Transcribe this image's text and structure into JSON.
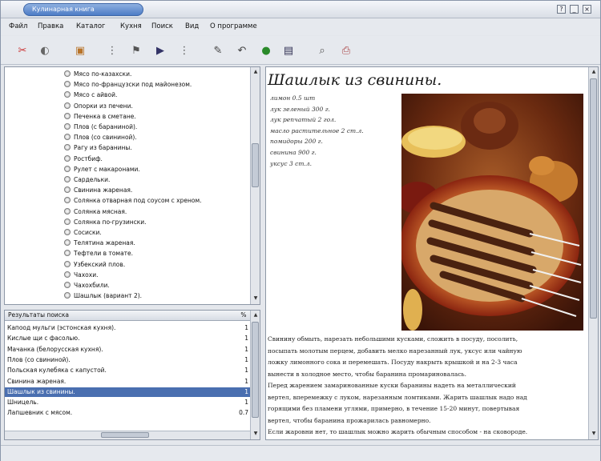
{
  "window": {
    "title": "Кулинарная книга"
  },
  "menu": [
    "Файл",
    "Правка",
    "Каталог",
    "Кухня",
    "Поиск",
    "Вид",
    "О программе"
  ],
  "toolbar": [
    "cut-icon",
    "eraser-icon",
    "book-icon",
    "bookmark-icon",
    "flag-icon",
    "play-icon",
    "bookmark-2-icon",
    "edit-icon",
    "undo-icon",
    "globe-icon",
    "paint-icon",
    "search-icon",
    "print-icon"
  ],
  "tree": [
    "Мясо по-казахски.",
    "Мясо по-французски под майонезом.",
    "Мясо с айвой.",
    "Опорки из печени.",
    "Печенка в сметане.",
    "Плов (с бараниной).",
    "Плов (со свининой).",
    "Рагу из баранины.",
    "Ростбиф.",
    "Рулет с макаронами.",
    "Сардельки.",
    "Свинина жареная.",
    "Солянка отварная под соусом с хреном.",
    "Солянка мясная.",
    "Солянка по-грузински.",
    "Сосиски.",
    "Телятина жареная.",
    "Тефтели в томате.",
    "Узбекский плов.",
    "Чахохи.",
    "Чахохбили.",
    "Шашлык (вариант 2)."
  ],
  "results": {
    "header": "Результаты поиска",
    "pct_header": "%",
    "rows": [
      {
        "name": "Капоод мульги (эстонская кухня).",
        "pct": "1"
      },
      {
        "name": "Кислые щи с фасолью.",
        "pct": "1"
      },
      {
        "name": "Мачанка (белорусская кухня).",
        "pct": "1"
      },
      {
        "name": "Плов (со свининой).",
        "pct": "1"
      },
      {
        "name": "Польская кулебяка с капустой.",
        "pct": "1"
      },
      {
        "name": "Свинина жареная.",
        "pct": "1"
      },
      {
        "name": "Шашлык из свинины.",
        "pct": "1"
      },
      {
        "name": "Шницель.",
        "pct": "1"
      },
      {
        "name": "Лапшевник с мясом.",
        "pct": "0.7"
      }
    ]
  },
  "recipe": {
    "title": "Шашлык из свинины.",
    "ingredients": [
      "лимон 0.5 шт",
      "лук зеленый 300 г.",
      "лук репчатый 2 гол.",
      "масло растительное 2 ст.л.",
      "помидоры 200 г.",
      "свинина 900 г.",
      "уксус 3 ст.л."
    ],
    "body": [
      "Свинину обмыть, нарезать небольшими кусками, сложить в посуду, посолить,",
      "посыпать молотым перцем, добавить мелко нарезанный лук, уксус или чайную",
      "ложку лимонного сока и перемешать. Посуду накрыть крышкой и на 2-3 часа",
      "вынести в холодное место, чтобы баранина промариновалась.",
      "Перед жарением замаринованные куски баранины надеть на металлический",
      "вертел, вперемежку с луком, нарезанным ломтиками. Жарить шашлык надо над",
      "горящими без пламени углями, примерно, в течение 15-20 минут, повертывая",
      "вертел, чтобы баранина прожарилась равномерно.",
      "Если жаровни нет, то шашлык можно жарить обычным способом - на сковороде."
    ]
  }
}
